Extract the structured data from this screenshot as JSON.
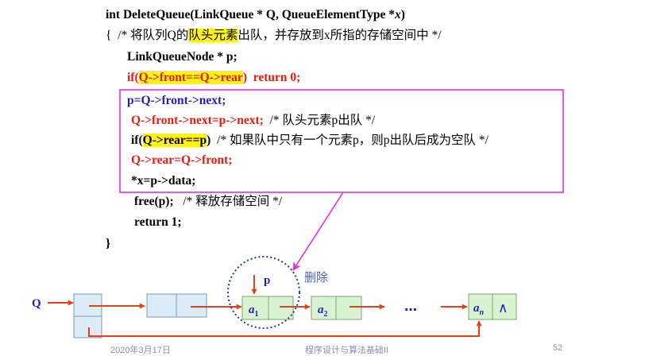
{
  "code": {
    "signature": {
      "a": "int DeleteQueue(LinkQueue * Q, QueueElementType *",
      "b": "x",
      "c": ")"
    },
    "l2": {
      "a": "{  /* 将队列Q的",
      "b": "队头元素",
      "c": "出队，并存放到x所指的存储空间中 */"
    },
    "l3": "LinkQueueNode * p;",
    "l4": {
      "a": "if(",
      "b": "Q->front==Q->rear",
      "c": ")  return 0;"
    },
    "l5": "p=Q->front->next;",
    "l6": {
      "a": "Q->front->next=p->next;",
      "b": "  /* 队头元素p出队 */"
    },
    "l7": {
      "a": "if(",
      "b": "Q->rear==p",
      "c": ")",
      "d": "  /* 如果队中只有一个元素p，则p出队后成为空队 */"
    },
    "l8": "Q->rear=Q->front;",
    "l9": "*x=p->data;",
    "l10": {
      "a": "free(p);",
      "b": "   /* 释放存储空间 */"
    },
    "l11": "return 1;",
    "l12": "}"
  },
  "diagram": {
    "q_label": "Q",
    "p_label": "p",
    "delete_label": "删除",
    "a1_base": "a",
    "a1_sub": "1",
    "a2_base": "a",
    "a2_sub": "2",
    "an_base": "a",
    "an_sub": "n",
    "ellipsis": "…",
    "null_symbol": "∧"
  },
  "footer": {
    "date": "2020年3月17日",
    "course": "程序设计与算法基础II",
    "page": "52"
  },
  "colors": {
    "highlight": "#fff21a",
    "code_red": "#e8190f",
    "code_blue": "#1f1fb8",
    "magenta_box": "#e030e0",
    "arrow_red": "#e8400f",
    "node_head_fill": "#dcecf7",
    "node_fill": "#d9f2d2",
    "dotted_circle": "#1c3f80",
    "delete_label": "#4a60c0"
  }
}
